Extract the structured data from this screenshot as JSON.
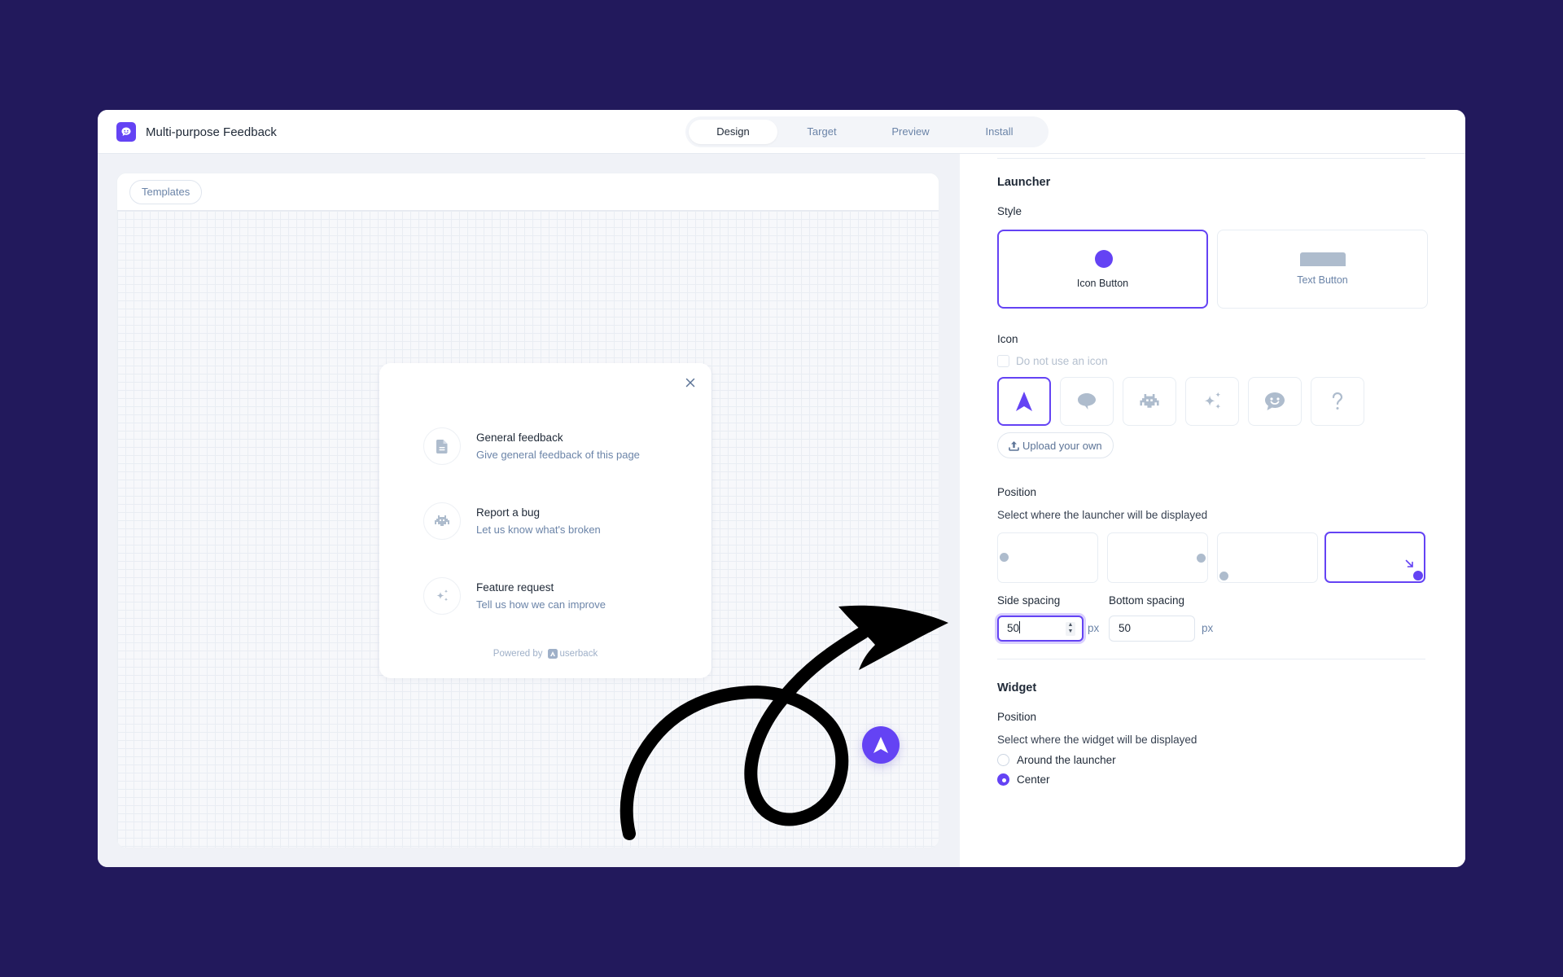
{
  "app": {
    "title": "Multi-purpose Feedback",
    "accent_color": "#6443f4",
    "background_color": "#22195c"
  },
  "tabs": [
    {
      "label": "Design",
      "active": true
    },
    {
      "label": "Target",
      "active": false
    },
    {
      "label": "Preview",
      "active": false
    },
    {
      "label": "Install",
      "active": false
    }
  ],
  "canvas": {
    "templates_label": "Templates",
    "widget": {
      "options": [
        {
          "title": "General feedback",
          "subtitle": "Give general feedback of this page",
          "icon": "document-icon"
        },
        {
          "title": "Report a bug",
          "subtitle": "Let us know what's broken",
          "icon": "bug-icon"
        },
        {
          "title": "Feature request",
          "subtitle": "Tell us how we can improve",
          "icon": "sparkles-icon"
        }
      ],
      "powered_by": "Powered by",
      "brand": "userback"
    },
    "launcher_icon": "navigation-arrow-icon"
  },
  "panel": {
    "launcher": {
      "heading": "Launcher",
      "style_label": "Style",
      "styles": [
        {
          "label": "Icon Button",
          "selected": true
        },
        {
          "label": "Text Button",
          "selected": false
        }
      ],
      "icon_label": "Icon",
      "no_icon_label": "Do not use an icon",
      "no_icon_checked": false,
      "icons": [
        {
          "name": "navigation-arrow-icon",
          "selected": true
        },
        {
          "name": "speech-bubble-icon",
          "selected": false
        },
        {
          "name": "bug-icon",
          "selected": false
        },
        {
          "name": "sparkles-icon",
          "selected": false
        },
        {
          "name": "smiley-chat-icon",
          "selected": false
        },
        {
          "name": "question-mark-icon",
          "selected": false
        }
      ],
      "upload_label": "Upload your own",
      "position_label": "Position",
      "position_helper": "Select where the launcher will be displayed",
      "positions": [
        {
          "name": "middle-left",
          "selected": false
        },
        {
          "name": "middle-right",
          "selected": false
        },
        {
          "name": "bottom-left",
          "selected": false
        },
        {
          "name": "bottom-right",
          "selected": true
        }
      ],
      "side_spacing_label": "Side spacing",
      "side_spacing_value": "50",
      "bottom_spacing_label": "Bottom spacing",
      "bottom_spacing_value": "50",
      "unit": "px"
    },
    "widget": {
      "heading": "Widget",
      "position_label": "Position",
      "position_helper": "Select where the widget will be displayed",
      "options": [
        {
          "label": "Around the launcher",
          "selected": false
        },
        {
          "label": "Center",
          "selected": true
        }
      ]
    }
  }
}
